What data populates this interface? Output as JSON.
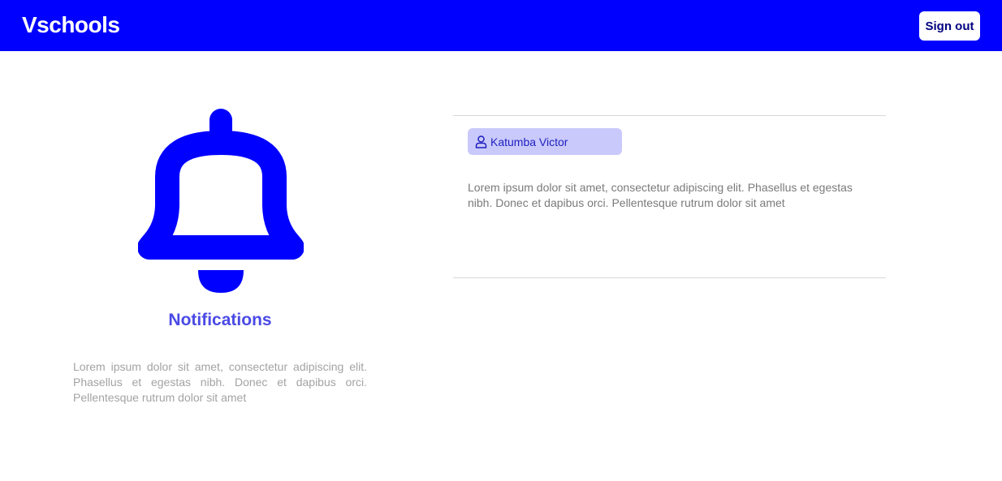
{
  "header": {
    "brand": "Vschools",
    "signout_label": "Sign out",
    "brand_color": "#0000ff"
  },
  "hero": {
    "icon": "bell-icon",
    "title": "Notifications",
    "description": "Lorem ipsum dolor sit amet, consectetur adipiscing elit. Phasellus et egestas nibh. Donec et dapibus orci. Pellentesque rutrum dolor sit amet"
  },
  "notification": {
    "author_icon": "person-icon",
    "author": "Katumba Victor",
    "body": "Lorem ipsum dolor sit amet, consectetur adipiscing elit. Phasellus et egestas nibh. Donec et dapibus orci. Pellentesque rutrum dolor sit amet"
  }
}
